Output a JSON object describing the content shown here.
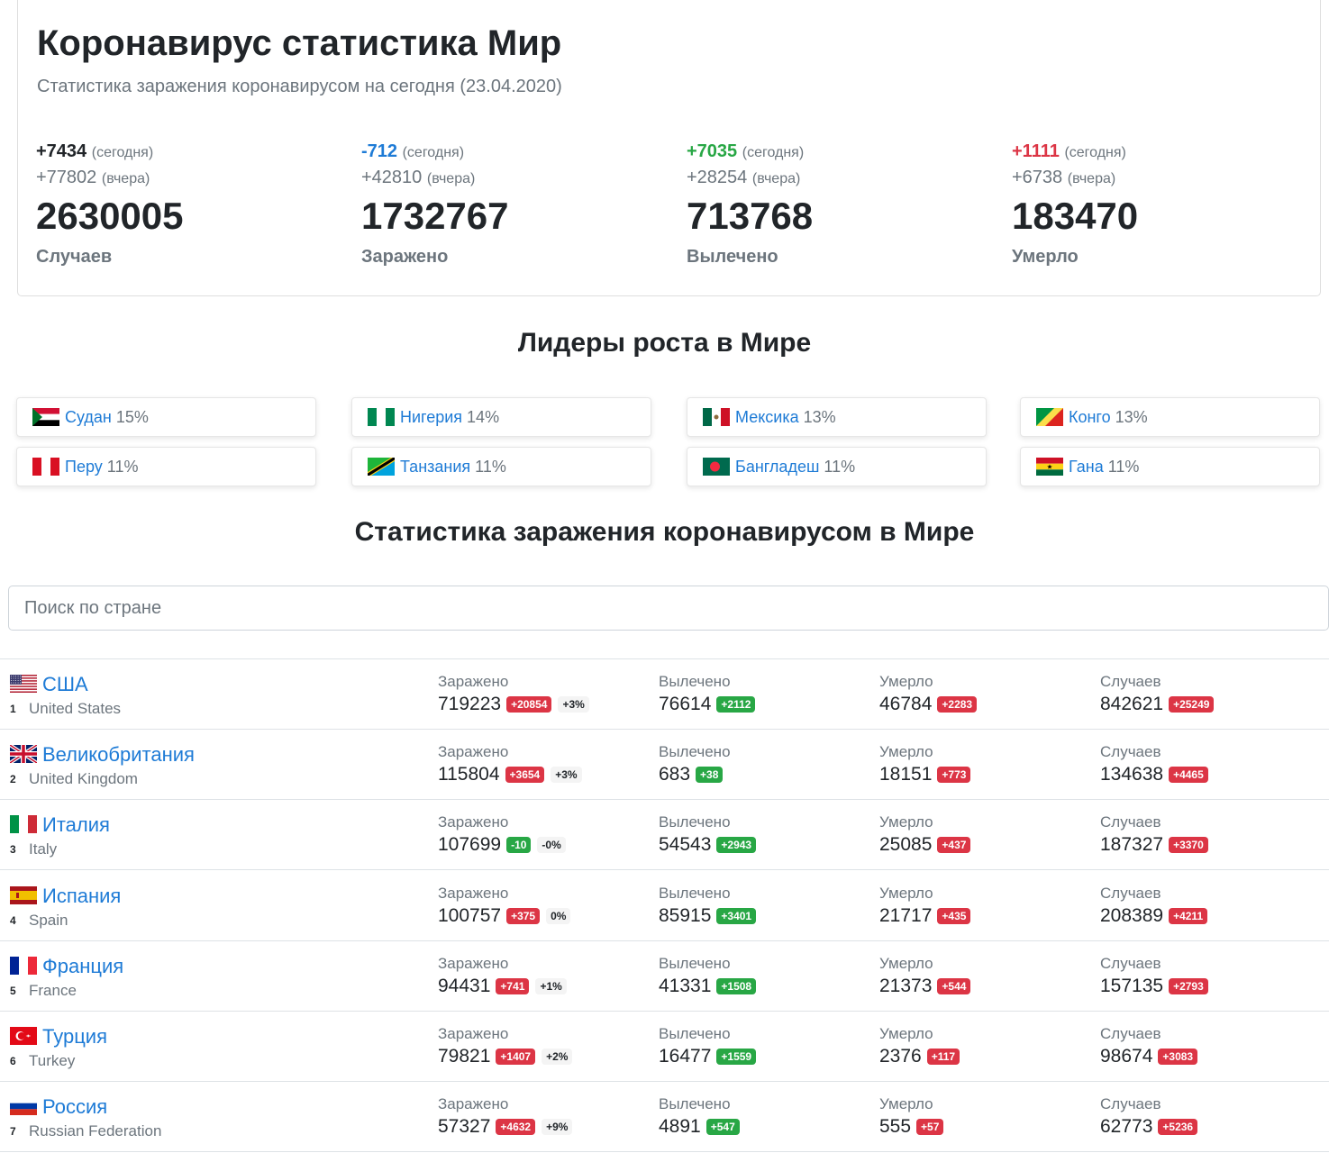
{
  "header": {
    "title": "Коронавирус статистика Мир",
    "subtitle": "Статистика заражения коронавирусом на сегодня (23.04.2020)"
  },
  "summary": [
    {
      "today_delta": "+7434",
      "today_label": "(сегодня)",
      "yesterday_delta": "+77802",
      "yesterday_label": "(вчера)",
      "total": "2630005",
      "label": "Случаев",
      "delta_color": "#212529"
    },
    {
      "today_delta": "-712",
      "today_label": "(сегодня)",
      "yesterday_delta": "+42810",
      "yesterday_label": "(вчера)",
      "total": "1732767",
      "label": "Заражено",
      "delta_color": "#1e7bd6"
    },
    {
      "today_delta": "+7035",
      "today_label": "(сегодня)",
      "yesterday_delta": "+28254",
      "yesterday_label": "(вчера)",
      "total": "713768",
      "label": "Вылечено",
      "delta_color": "#28a745"
    },
    {
      "today_delta": "+1111",
      "today_label": "(сегодня)",
      "yesterday_delta": "+6738",
      "yesterday_label": "(вчера)",
      "total": "183470",
      "label": "Умерло",
      "delta_color": "#dc3545"
    }
  ],
  "leaders_title": "Лидеры роста в Мире",
  "leaders": [
    {
      "name": "Судан",
      "pct": "15%",
      "flag": "sudan"
    },
    {
      "name": "Нигерия",
      "pct": "14%",
      "flag": "nigeria"
    },
    {
      "name": "Мексика",
      "pct": "13%",
      "flag": "mexico"
    },
    {
      "name": "Конго",
      "pct": "13%",
      "flag": "congo"
    },
    {
      "name": "Перу",
      "pct": "11%",
      "flag": "peru"
    },
    {
      "name": "Танзания",
      "pct": "11%",
      "flag": "tanzania"
    },
    {
      "name": "Бангладеш",
      "pct": "11%",
      "flag": "bangladesh"
    },
    {
      "name": "Гана",
      "pct": "11%",
      "flag": "ghana"
    }
  ],
  "stats_title": "Статистика заражения коронавирусом в Мире",
  "search": {
    "placeholder": "Поиск по стране"
  },
  "metric_labels": {
    "infected": "Заражено",
    "recovered": "Вылечено",
    "died": "Умерло",
    "cases": "Случаев"
  },
  "countries": [
    {
      "rank": "1",
      "name": "США",
      "en": "United States",
      "flag": "usa",
      "infected": "719223",
      "infected_delta": "+20854",
      "infected_delta_color": "red",
      "infected_pct": "+3%",
      "recovered": "76614",
      "recovered_delta": "+2112",
      "died": "46784",
      "died_delta": "+2283",
      "cases": "842621",
      "cases_delta": "+25249"
    },
    {
      "rank": "2",
      "name": "Великобритания",
      "en": "United Kingdom",
      "flag": "uk",
      "infected": "115804",
      "infected_delta": "+3654",
      "infected_delta_color": "red",
      "infected_pct": "+3%",
      "recovered": "683",
      "recovered_delta": "+38",
      "died": "18151",
      "died_delta": "+773",
      "cases": "134638",
      "cases_delta": "+4465"
    },
    {
      "rank": "3",
      "name": "Италия",
      "en": "Italy",
      "flag": "italy",
      "infected": "107699",
      "infected_delta": "-10",
      "infected_delta_color": "green",
      "infected_pct": "-0%",
      "recovered": "54543",
      "recovered_delta": "+2943",
      "died": "25085",
      "died_delta": "+437",
      "cases": "187327",
      "cases_delta": "+3370"
    },
    {
      "rank": "4",
      "name": "Испания",
      "en": "Spain",
      "flag": "spain",
      "infected": "100757",
      "infected_delta": "+375",
      "infected_delta_color": "red",
      "infected_pct": "0%",
      "recovered": "85915",
      "recovered_delta": "+3401",
      "died": "21717",
      "died_delta": "+435",
      "cases": "208389",
      "cases_delta": "+4211"
    },
    {
      "rank": "5",
      "name": "Франция",
      "en": "France",
      "flag": "france",
      "infected": "94431",
      "infected_delta": "+741",
      "infected_delta_color": "red",
      "infected_pct": "+1%",
      "recovered": "41331",
      "recovered_delta": "+1508",
      "died": "21373",
      "died_delta": "+544",
      "cases": "157135",
      "cases_delta": "+2793"
    },
    {
      "rank": "6",
      "name": "Турция",
      "en": "Turkey",
      "flag": "turkey",
      "infected": "79821",
      "infected_delta": "+1407",
      "infected_delta_color": "red",
      "infected_pct": "+2%",
      "recovered": "16477",
      "recovered_delta": "+1559",
      "died": "2376",
      "died_delta": "+117",
      "cases": "98674",
      "cases_delta": "+3083"
    },
    {
      "rank": "7",
      "name": "Россия",
      "en": "Russian Federation",
      "flag": "russia",
      "infected": "57327",
      "infected_delta": "+4632",
      "infected_delta_color": "red",
      "infected_pct": "+9%",
      "recovered": "4891",
      "recovered_delta": "+547",
      "died": "555",
      "died_delta": "+57",
      "cases": "62773",
      "cases_delta": "+5236"
    }
  ]
}
